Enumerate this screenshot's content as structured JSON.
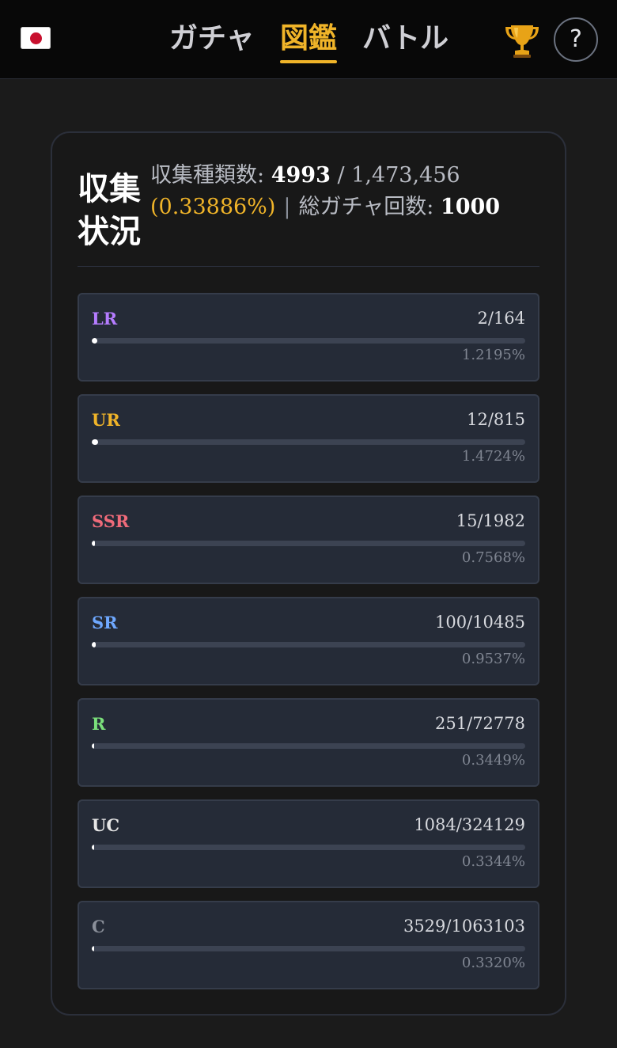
{
  "header": {
    "flag_icon": "japan-flag-icon",
    "tabs": [
      {
        "label": "ガチャ",
        "active": false
      },
      {
        "label": "図鑑",
        "active": true
      },
      {
        "label": "バトル",
        "active": false
      }
    ],
    "trophy_icon": "trophy-icon",
    "help_label": "?"
  },
  "summary": {
    "title": "収集状況",
    "collected_label": "収集種類数:",
    "collected_value": "4993",
    "slash": "/",
    "total_value": "1,473,456",
    "percent": "(0.33886%)",
    "separator": "|",
    "pulls_label": "総ガチャ回数:",
    "pulls_value": "1000"
  },
  "rarities": [
    {
      "name": "LR",
      "count": "2/164",
      "percent": "1.2195%",
      "fraction": 0.012195,
      "color": "#b57cff"
    },
    {
      "name": "UR",
      "count": "12/815",
      "percent": "1.4724%",
      "fraction": 0.014724,
      "color": "#f0b429"
    },
    {
      "name": "SSR",
      "count": "15/1982",
      "percent": "0.7568%",
      "fraction": 0.007568,
      "color": "#f06b7a"
    },
    {
      "name": "SR",
      "count": "100/10485",
      "percent": "0.9537%",
      "fraction": 0.009537,
      "color": "#6ea8ff"
    },
    {
      "name": "R",
      "count": "251/72778",
      "percent": "0.3449%",
      "fraction": 0.003449,
      "color": "#7be07b"
    },
    {
      "name": "UC",
      "count": "1084/324129",
      "percent": "0.3344%",
      "fraction": 0.003344,
      "color": "#e6e6e6"
    },
    {
      "name": "C",
      "count": "3529/1063103",
      "percent": "0.3320%",
      "fraction": 0.00332,
      "color": "#8a8f99"
    }
  ]
}
